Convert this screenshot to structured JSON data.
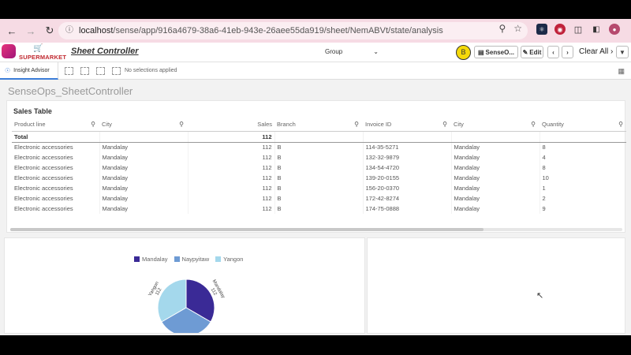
{
  "browser": {
    "url_host": "localhost",
    "url_path": "/sense/app/916a4679-38a6-41eb-943e-26aee55da919/sheet/NemABVt/state/analysis"
  },
  "app": {
    "logo_text": "SUPERMARKET",
    "sheet_title": "Sheet Controller",
    "group_label": "Group",
    "badge_letter": "B",
    "senseops_label": "SenseO...",
    "edit_label": "Edit",
    "clear_all_label": "Clear All"
  },
  "toolbar": {
    "insight_label": "Insight Advisor",
    "no_selections": "No selections applied"
  },
  "page_title": "SenseOps_SheetController",
  "table": {
    "title": "Sales Table",
    "columns": [
      "Product line",
      "City",
      "Sales",
      "Branch",
      "Invoice ID",
      "City",
      "Quantity"
    ],
    "total": {
      "label": "Total",
      "sales": "112"
    },
    "rows": [
      [
        "Electronic accessories",
        "Mandalay",
        "112",
        "B",
        "114-35-5271",
        "Mandalay",
        "8"
      ],
      [
        "Electronic accessories",
        "Mandalay",
        "112",
        "B",
        "132-32-9879",
        "Mandalay",
        "4"
      ],
      [
        "Electronic accessories",
        "Mandalay",
        "112",
        "B",
        "134-54-4720",
        "Mandalay",
        "8"
      ],
      [
        "Electronic accessories",
        "Mandalay",
        "112",
        "B",
        "139-20-0155",
        "Mandalay",
        "10"
      ],
      [
        "Electronic accessories",
        "Mandalay",
        "112",
        "B",
        "156-20-0370",
        "Mandalay",
        "1"
      ],
      [
        "Electronic accessories",
        "Mandalay",
        "112",
        "B",
        "172-42-8274",
        "Mandalay",
        "2"
      ],
      [
        "Electronic accessories",
        "Mandalay",
        "112",
        "B",
        "174-75-0888",
        "Mandalay",
        "9"
      ]
    ]
  },
  "chart_data": {
    "type": "pie",
    "title": "",
    "legend_position": "top",
    "categories": [
      "Mandalay",
      "Naypyitaw",
      "Yangon"
    ],
    "values": [
      112,
      112,
      112
    ],
    "colors": [
      "#3a2a96",
      "#6e9bd4",
      "#a4d8ec"
    ],
    "slice_labels": [
      "Mandalay",
      "Naypyitaw",
      "Yangon"
    ],
    "slice_values": [
      "112",
      "112",
      "112"
    ]
  }
}
